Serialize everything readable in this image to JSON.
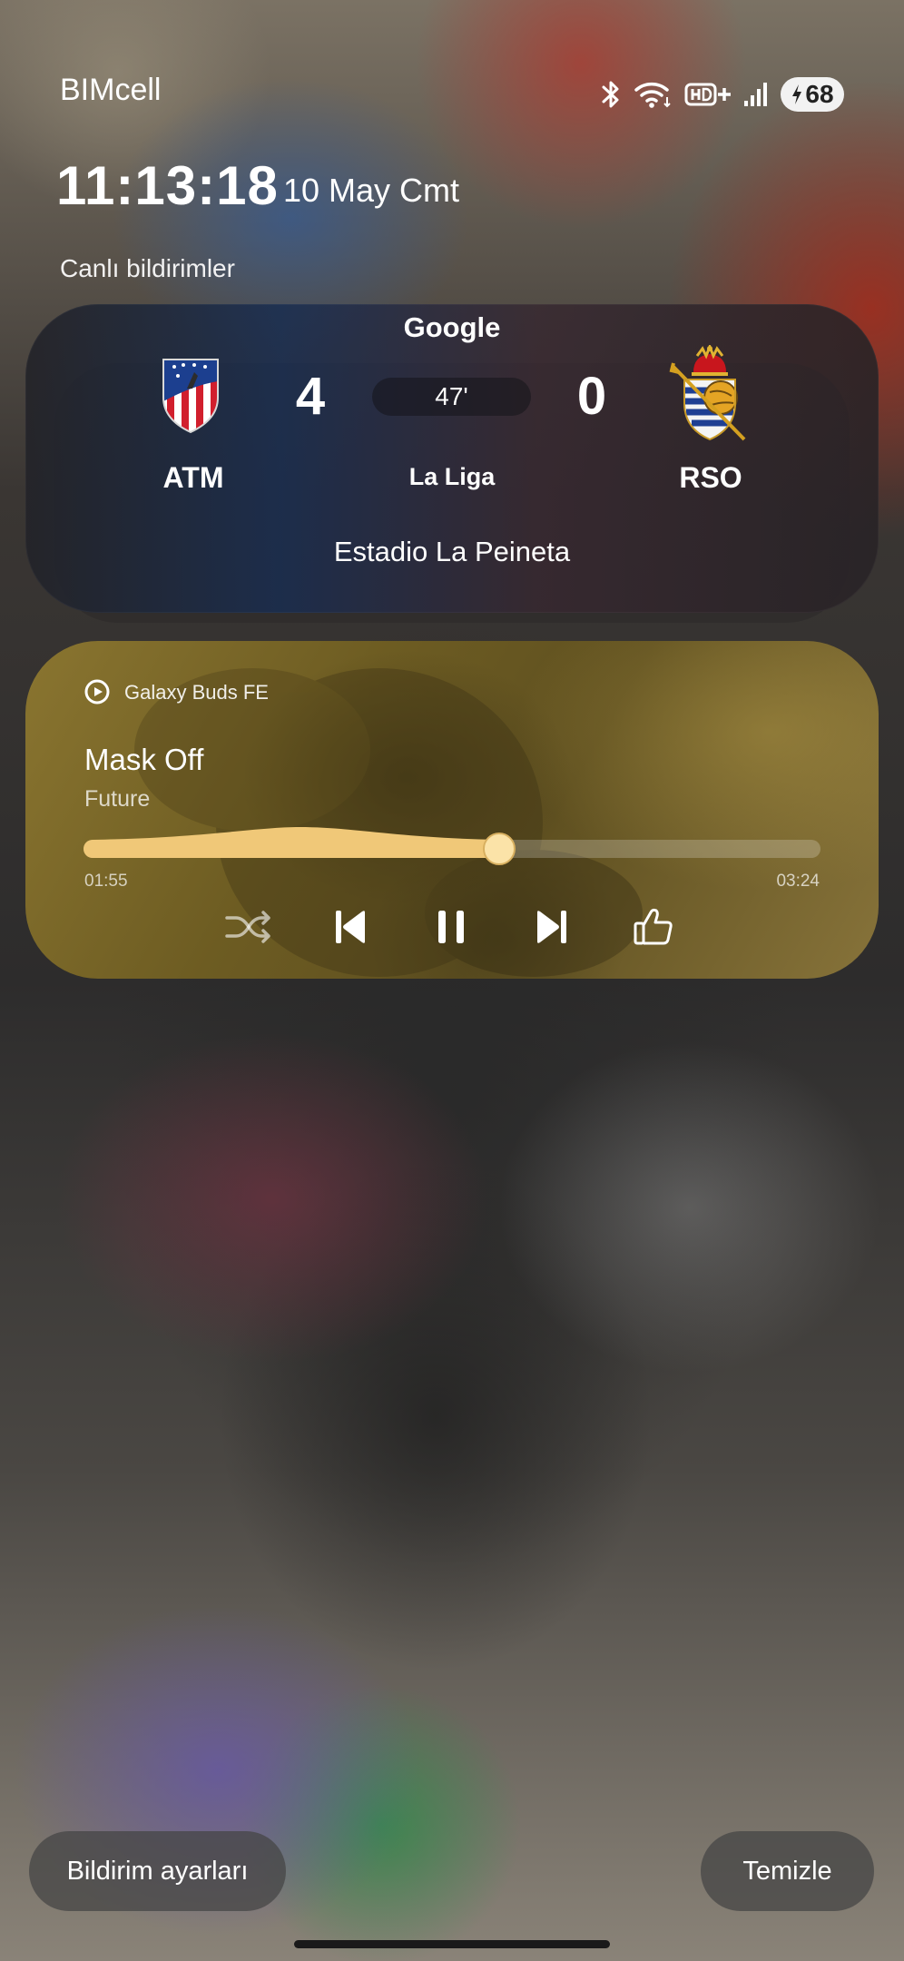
{
  "status_bar": {
    "carrier": "BIMcell",
    "battery_level": "68",
    "icons": [
      "bluetooth-icon",
      "wifi-icon",
      "hd-plus-icon",
      "signal-icon",
      "charging-icon"
    ]
  },
  "lockscreen": {
    "time": "11:13:18",
    "date": "10 May Cmt",
    "section_label": "Canlı bildirimler"
  },
  "score_card": {
    "provider": "Google",
    "home_team": "ATM",
    "away_team": "RSO",
    "home_score": "4",
    "away_score": "0",
    "minute": "47'",
    "league": "La Liga",
    "venue": "Estadio La Peineta"
  },
  "media": {
    "source": "Galaxy Buds FE",
    "title": "Mask Off",
    "artist": "Future",
    "elapsed": "01:55",
    "duration": "03:24",
    "progress": 0.564,
    "accent": "#f0c878"
  },
  "footer": {
    "settings_label": "Bildirim ayarları",
    "clear_label": "Temizle"
  }
}
